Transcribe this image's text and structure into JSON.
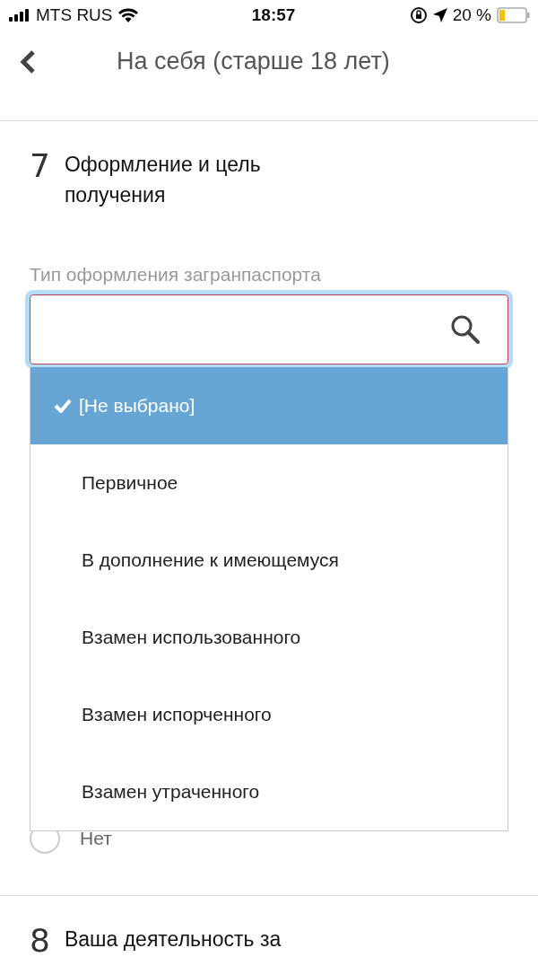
{
  "status_bar": {
    "carrier": "MTS RUS",
    "time": "18:57",
    "battery": "20 %"
  },
  "header": {
    "title": "На себя (старше 18 лет)"
  },
  "sections": [
    {
      "number": "7",
      "title": "Оформление и цель получения"
    }
  ],
  "field": {
    "label": "Тип оформления загранпаспорта",
    "focused": true
  },
  "dropdown": {
    "options": [
      {
        "label": "[Не выбрано]",
        "selected": true
      },
      {
        "label": "Первичное",
        "selected": false
      },
      {
        "label": "В дополнение к имеющемуся",
        "selected": false
      },
      {
        "label": "Взамен использованного",
        "selected": false
      },
      {
        "label": "Взамен испорченного",
        "selected": false
      },
      {
        "label": "Взамен утраченного",
        "selected": false
      }
    ]
  },
  "radio": {
    "label": "Нет",
    "selected": false
  },
  "next_section": {
    "number": "8",
    "title": "Ваша деятельность за"
  }
}
